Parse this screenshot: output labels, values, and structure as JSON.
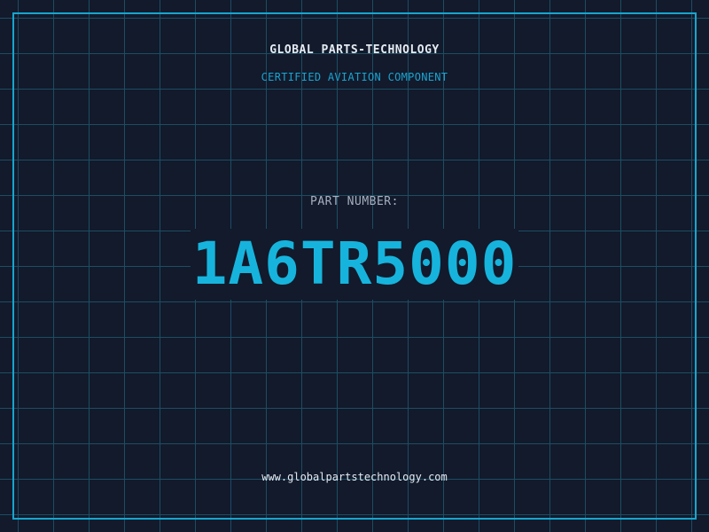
{
  "header": {
    "company": "GLOBAL PARTS-TECHNOLOGY",
    "subtitle": "CERTIFIED AVIATION COMPONENT"
  },
  "part": {
    "label": "PART NUMBER:",
    "number": "1A6TR5000"
  },
  "footer": {
    "website": "www.globalpartstechnology.com"
  },
  "colors": {
    "background": "#121a2c",
    "grid": "#1d4d62",
    "accent": "#16b4dc",
    "text": "#e6ebf2",
    "muted": "#a7b0bf"
  }
}
